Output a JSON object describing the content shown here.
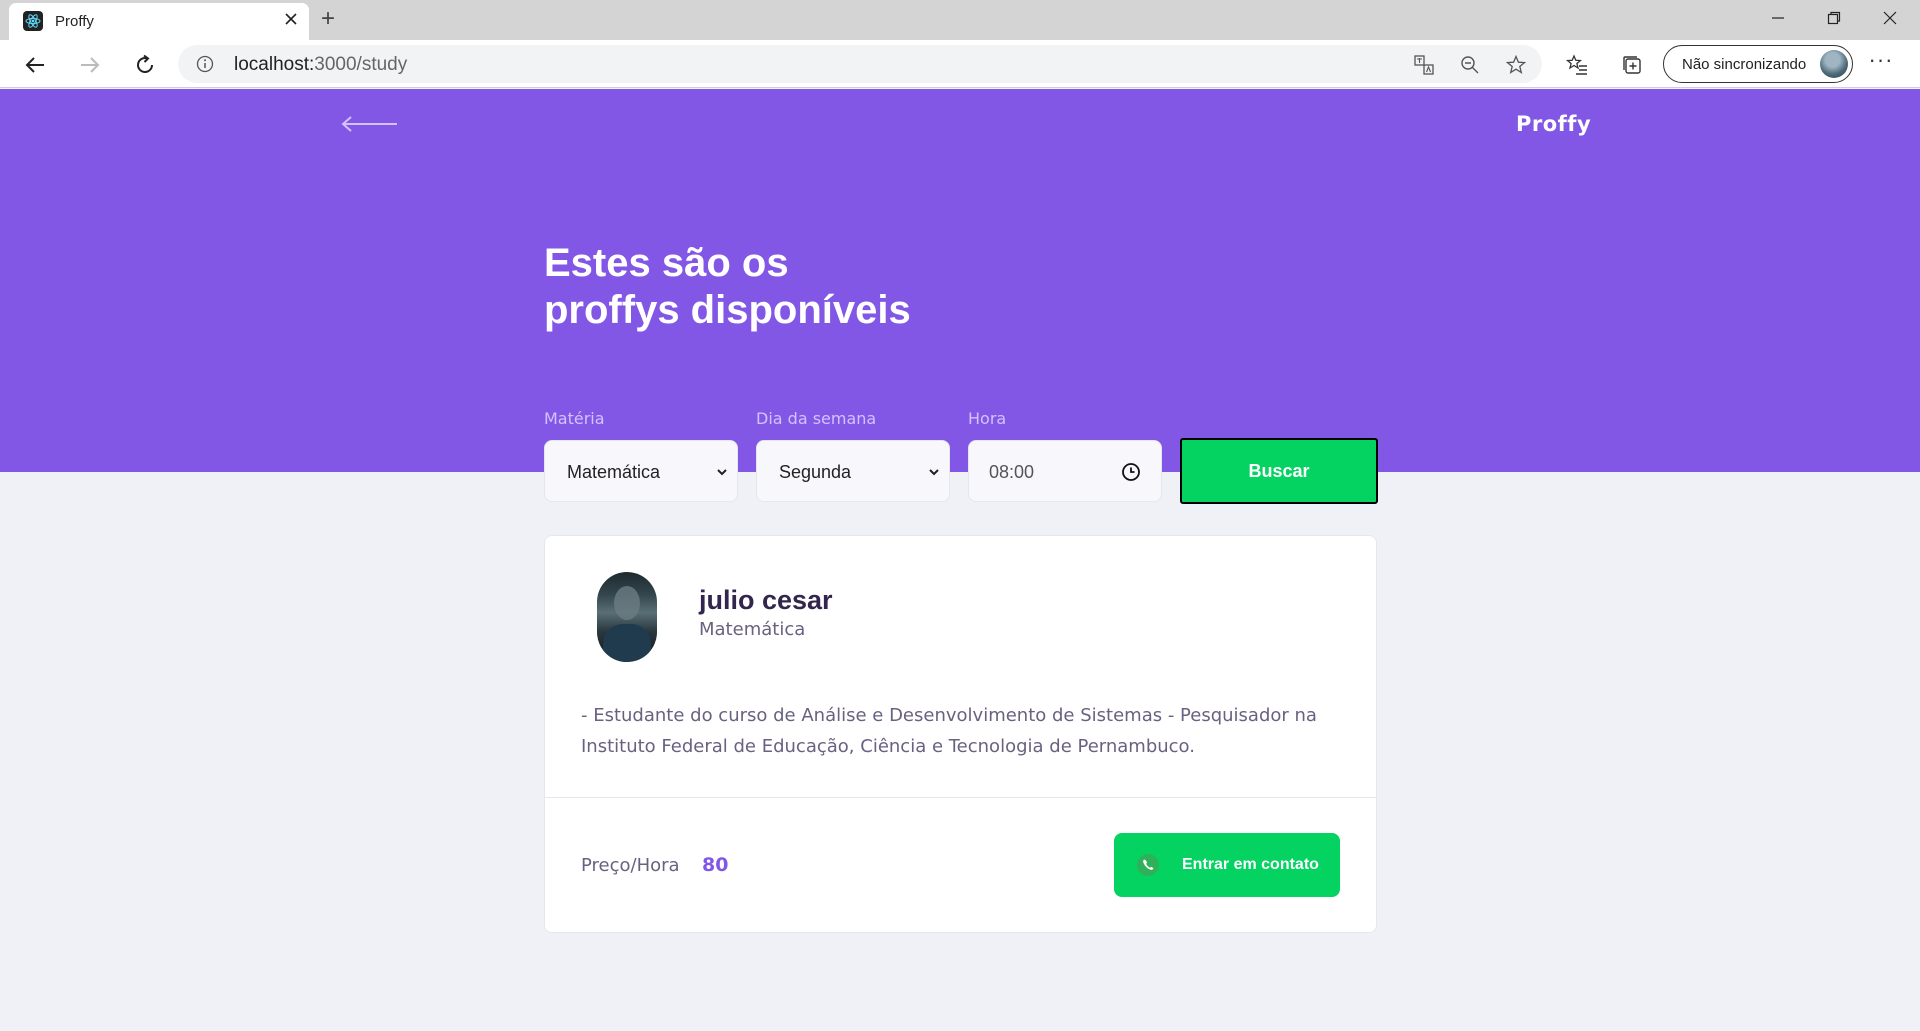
{
  "browser": {
    "tab_title": "Proffy",
    "new_tab_label": "+",
    "url_host": "localhost:",
    "url_path": "3000/study",
    "profile_label": "Não sincronizando",
    "more_label": "···"
  },
  "header": {
    "brand": "Proffy",
    "title_line1": "Estes são os",
    "title_line2": "proffys disponíveis"
  },
  "filters": {
    "subject": {
      "label": "Matéria",
      "value": "Matemática"
    },
    "week_day": {
      "label": "Dia da semana",
      "value": "Segunda"
    },
    "time": {
      "label": "Hora",
      "value": "08:00"
    },
    "submit_label": "Buscar"
  },
  "teacher": {
    "name": "julio cesar",
    "subject": "Matemática",
    "bio": "- Estudante do curso de Análise e Desenvolvimento de Sistemas - Pesquisador na Instituto Federal de Educação, Ciência e Tecnologia de Pernambuco.",
    "price_label": "Preço/Hora",
    "price_value": "80",
    "contact_label": "Entrar em contato"
  },
  "colors": {
    "primary": "#8257E5",
    "secondary": "#04D361",
    "background": "#F0F0F7",
    "title_text": "#32264D",
    "body_text": "#6A6180"
  }
}
